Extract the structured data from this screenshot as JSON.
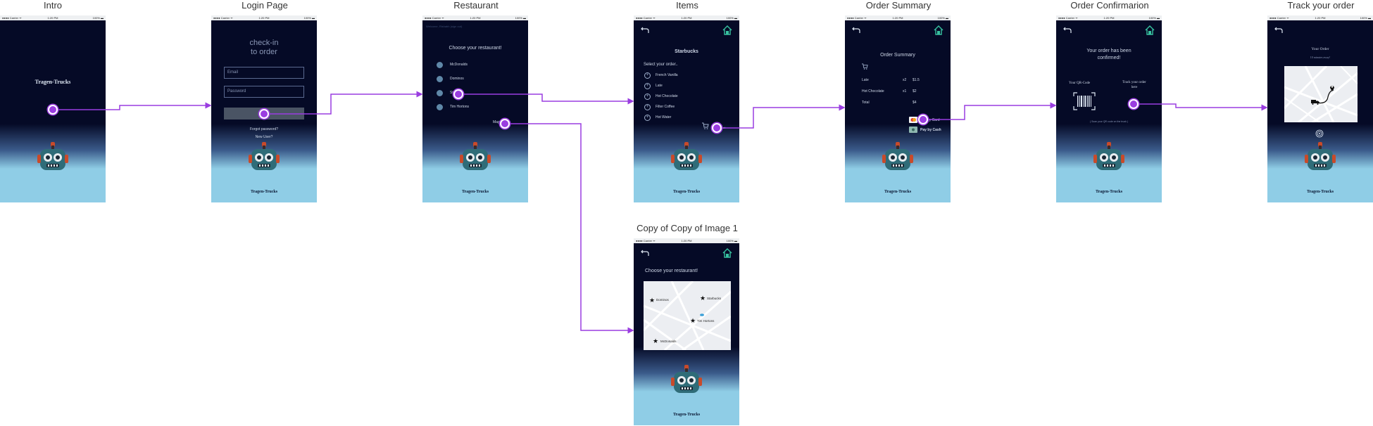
{
  "titles": {
    "intro": "Intro",
    "login": "Login Page",
    "restaurant": "Restaurant",
    "items": "Items",
    "order_summary": "Order Summary",
    "order_confirmation": "Order Confirmarion",
    "track": "Track your order",
    "copy": "Copy of Copy of Image 1"
  },
  "status_bar": {
    "carrier": "●●●● Carrier ᯤ",
    "time": "1:20 PM",
    "battery": "100% ▬"
  },
  "brand": "Tragen-Trucks",
  "login": {
    "heading_line1": "check-in",
    "heading_line2": "to order",
    "email_placeholder": "Email",
    "password_placeholder": "Password",
    "submit_label": "Se",
    "forgot": "Forgot password?",
    "new_user": "New User?"
  },
  "restaurant": {
    "welcome": "Welcome, Rishabh (sign out)",
    "heading": "Choose your restaurant!",
    "options": [
      "McDonalds",
      "Dominos",
      "St",
      "Tim Hortons"
    ],
    "map_link": "Map"
  },
  "items": {
    "restaurant_name": "Starbucks",
    "heading": "Select your order..",
    "list": [
      "French Vanilla",
      "Late",
      "Hot Chocolate",
      "Filter Coffee",
      "Hot Water"
    ],
    "cart_label": "Next"
  },
  "order_summary": {
    "heading": "Order Summary",
    "rows": [
      {
        "name": "Late",
        "qty": "x2",
        "price": "$1.5"
      },
      {
        "name": "Hot Chocolate",
        "qty": "x1",
        "price": "$2"
      }
    ],
    "total_label": "Total",
    "total_value": "$4",
    "card_label": "Pay by Card",
    "cash_label": "Pay by Cash"
  },
  "confirmation": {
    "heading_line1": "Your order has been",
    "heading_line2": "confirmed!",
    "qr_label": "Your QR-Code",
    "track_line1": "Track your order",
    "track_line2": "here",
    "scan_hint": "( Scan your QR code on the truck )"
  },
  "track": {
    "heading": "Your Order",
    "eta": "10 minutes away!"
  },
  "copy": {
    "heading": "Choose your restaurant!",
    "pins": [
      "Dominos",
      "Starbucks",
      "Tim Hortons",
      "McDonalds"
    ]
  },
  "colors": {
    "accent": "#9a3de0",
    "screen_dark": "#050a26",
    "screen_light": "#8fcde6"
  }
}
